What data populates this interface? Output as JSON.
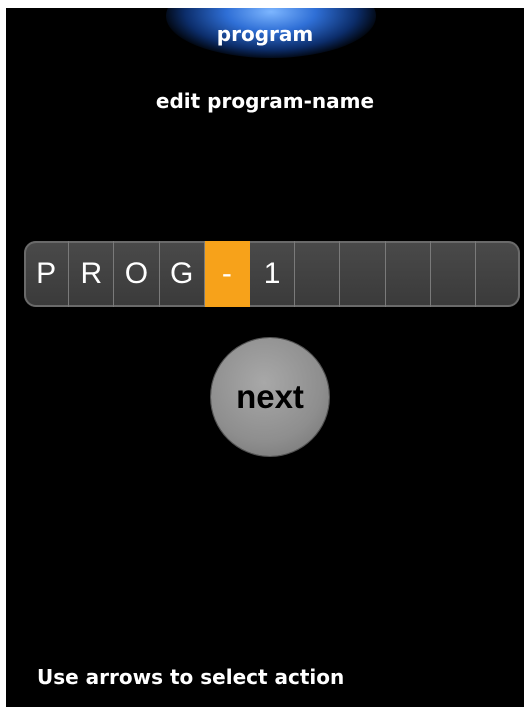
{
  "header": {
    "title": "program"
  },
  "subtitle": "edit program-name",
  "name_editor": {
    "cells": [
      "P",
      "R",
      "O",
      "G",
      "-",
      "1",
      "",
      "",
      "",
      "",
      ""
    ],
    "selected_index": 4,
    "accent_color": "#f7a21a"
  },
  "next_button": {
    "label": "next"
  },
  "footer": {
    "hint": "Use arrows to select action"
  }
}
